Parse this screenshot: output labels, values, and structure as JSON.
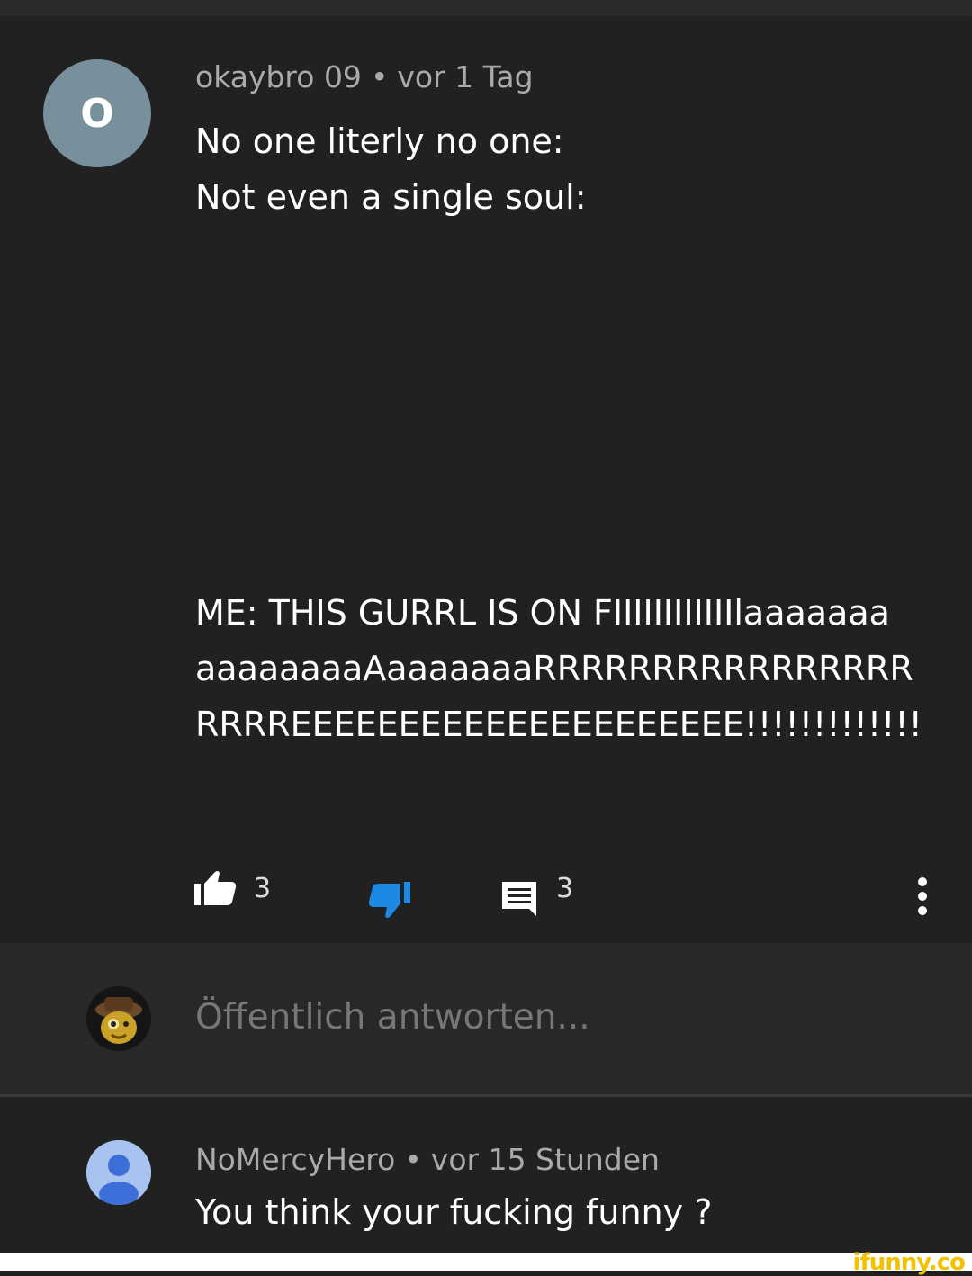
{
  "comment": {
    "avatar_letter": "O",
    "author": "okaybro 09",
    "separator": "•",
    "time": "vor 1 Tag",
    "lines": [
      "No one literly no one:",
      "Not even a single soul:",
      "ME: THIS GURRL IS ON FIIIIIIIIIIIIlaaaaaaa",
      "aaaaaaaaAaaaaaaaRRRRRRRRRRRRRRRR",
      "RRRREEEEEEEEEEEEEEEEEEEEE!!!!!!!!!!!!!"
    ],
    "like_count": "3",
    "reply_count": "3",
    "icons": {
      "like": "thumbs-up-icon",
      "dislike": "thumbs-down-icon",
      "reply": "comment-icon",
      "more": "more-vertical-icon"
    },
    "colors": {
      "dislike_active": "#1e88e5"
    }
  },
  "reply_box": {
    "placeholder": "Öffentlich antworten..."
  },
  "reply": {
    "author": "NoMercyHero",
    "separator": "•",
    "time": "vor 15 Stunden",
    "text": "You think your fucking funny ?"
  },
  "watermark": "ifunny.co"
}
